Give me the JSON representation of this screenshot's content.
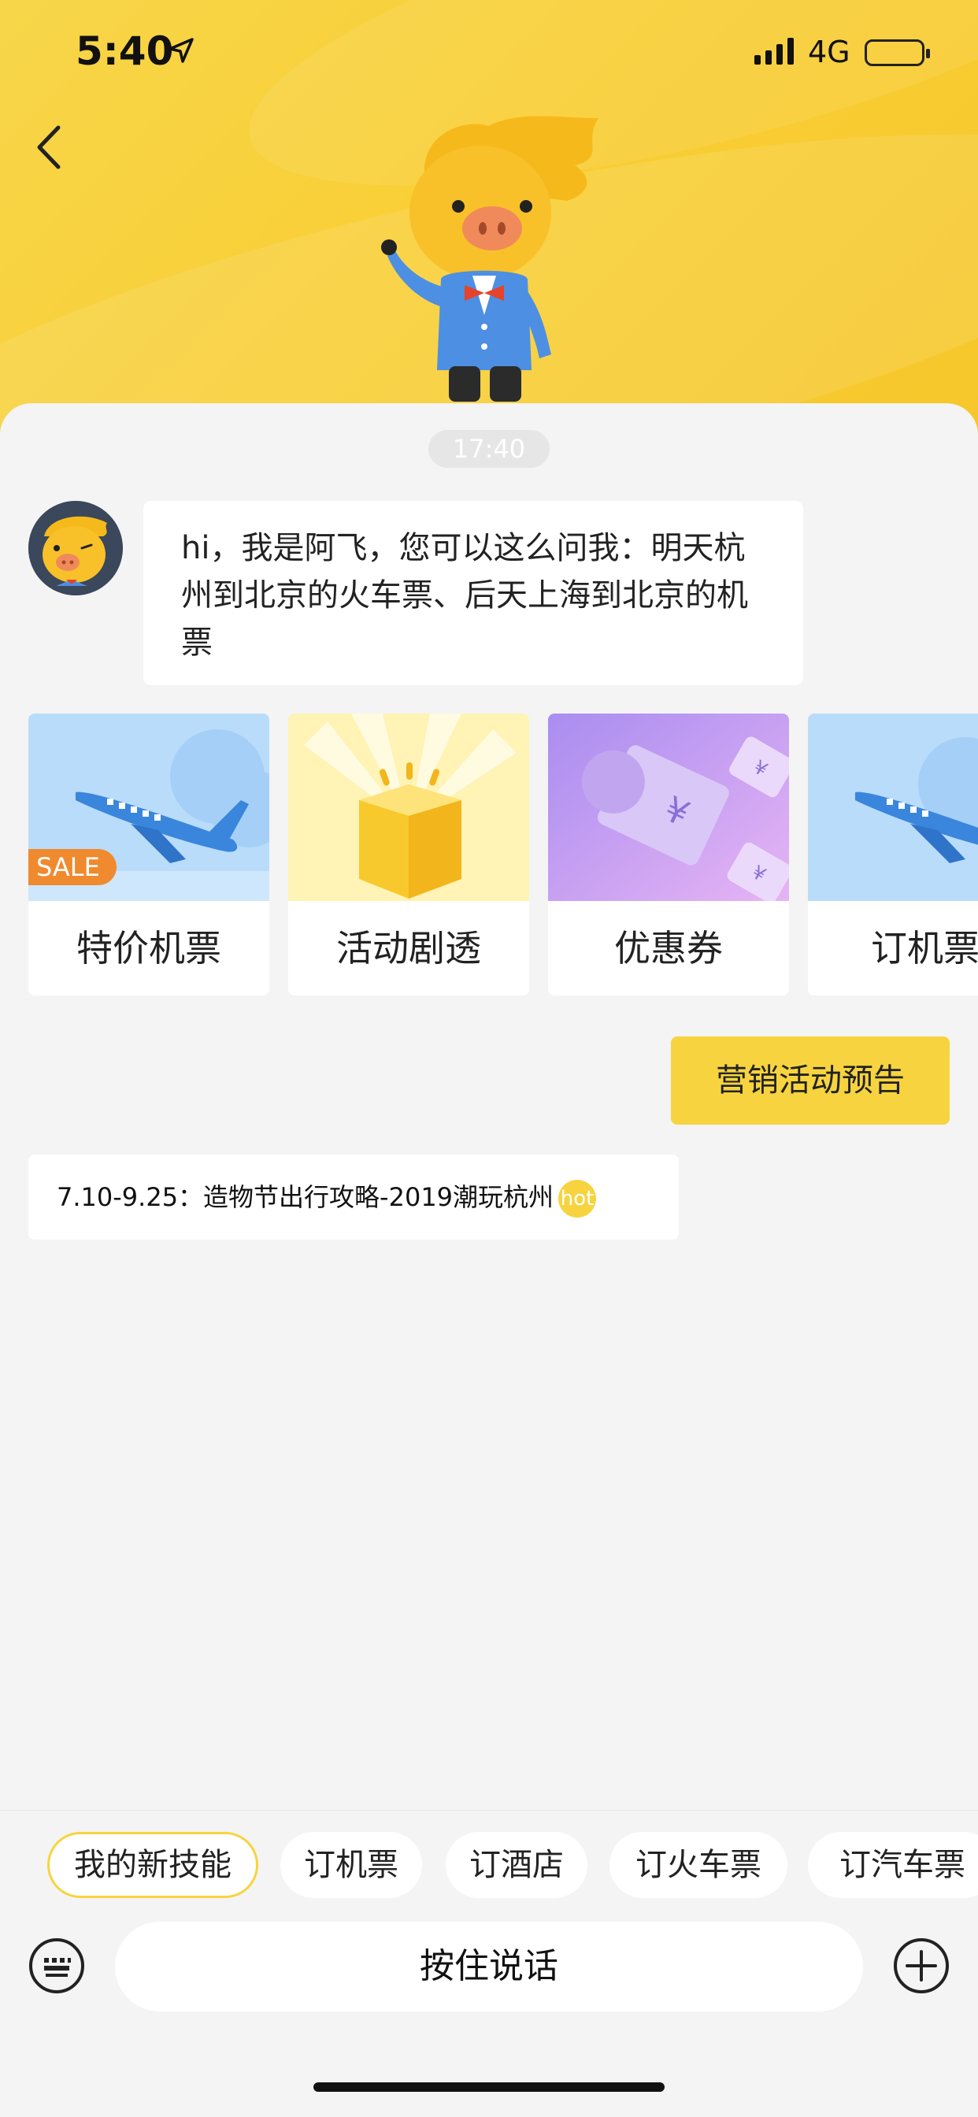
{
  "status_bar": {
    "time": "5:40",
    "network": "4G"
  },
  "chat": {
    "timestamp": "17:40",
    "bot_message": "hi，我是阿飞，您可以这么问我：明天杭州到北京的火车票、后天上海到北京的机票"
  },
  "cards": [
    {
      "label": "特价机票",
      "badge": "SALE"
    },
    {
      "label": "活动剧透"
    },
    {
      "label": "优惠券"
    },
    {
      "label": "订机票"
    }
  ],
  "promo_button": "营销活动预告",
  "message_link": {
    "text": "7.10-9.25：造物节出行攻略-2019潮玩杭州",
    "badge": "hot"
  },
  "quick_chips": [
    "我的新技能",
    "订机票",
    "订酒店",
    "订火车票",
    "订汽车票"
  ],
  "input": {
    "voice_label": "按住说话"
  },
  "icons": {
    "back": "chevron-left-icon",
    "location": "location-arrow-icon",
    "keyboard": "keyboard-icon",
    "plus": "plus-circle-icon"
  },
  "colors": {
    "accent": "#f7d43f",
    "sale": "#f08a2e",
    "header_yellow": "#f9cf36"
  }
}
